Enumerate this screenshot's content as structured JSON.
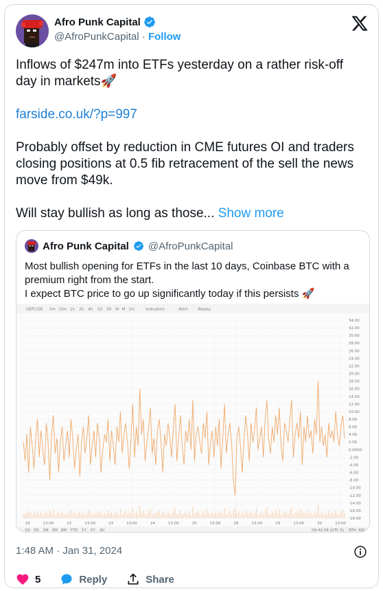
{
  "author": {
    "name": "Afro Punk Capital",
    "handle": "@AfroPunkCapital",
    "separator": "·",
    "follow": "Follow"
  },
  "tweet": {
    "para1": "Inflows of $247m into ETFs yesterday on a rather risk-off day in markets🚀",
    "link": "farside.co.uk/?p=997",
    "para3": "Probably offset by reduction in CME futures OI and traders closing positions at 0.5 fib retracement of the sell the news move from $49k.",
    "para4": "Will stay bullish as long as those...",
    "show_more": "Show more"
  },
  "quote": {
    "name": "Afro Punk Capital",
    "handle": "@AfroPunkCapital",
    "line1": "Most bullish opening for ETFs in the last 10 days, Coinbase BTC with a premium right from the start.",
    "line2": "I expect BTC price to go up significantly today if this persists 🚀"
  },
  "chart_toolbar": {
    "symbol": "GBTC/GE",
    "intervals": [
      "5m",
      "15m",
      "1h",
      "2h",
      "4h",
      "1D",
      "3D",
      "W",
      "M",
      "1m"
    ],
    "indicators": "Indicators",
    "alert": "Alert",
    "replay": "Replay",
    "ranges": [
      "1D",
      "5D",
      "1M",
      "3M",
      "6M",
      "YTD",
      "1Y",
      "5Y",
      "All"
    ],
    "clock": "09:42:58 (UTC-5)",
    "rth": "RTH",
    "adj": "ADJ"
  },
  "chart_data": {
    "type": "line",
    "y_ticks": [
      "34.00",
      "32.00",
      "30.00",
      "28.00",
      "26.00",
      "24.00",
      "22.00",
      "20.00",
      "18.00",
      "16.00",
      "14.00",
      "12.00",
      "10.00",
      "8.00",
      "6.00",
      "4.00",
      "2.00",
      "0.0000",
      "-2.00",
      "-4.00",
      "-6.00",
      "-8.00",
      "-10.00",
      "-12.00",
      "-14.00",
      "-16.00",
      "-18.00"
    ],
    "x_ticks": [
      "19",
      "13:00",
      "22",
      "13:00",
      "23",
      "13:00",
      "24",
      "13:00",
      "25",
      "13:00",
      "26",
      "13:00",
      "29",
      "13:00",
      "30",
      "13:00"
    ],
    "ylim": [
      -18,
      34
    ],
    "series_color": "#f0a868",
    "values": [
      2,
      -3,
      4,
      -6,
      6,
      1,
      -5,
      3,
      8,
      -2,
      5,
      0,
      -4,
      7,
      2,
      -8,
      4,
      9,
      -1,
      3,
      -6,
      2,
      6,
      -3,
      1,
      5,
      -2,
      8,
      3,
      -5,
      0,
      4,
      -7,
      2,
      6,
      -1,
      3,
      9,
      -4,
      1,
      5,
      -2,
      7,
      3,
      -6,
      0,
      4,
      2,
      8,
      -3,
      5,
      1,
      -4,
      6,
      2,
      10,
      -1,
      4,
      7,
      2,
      -5,
      3,
      12,
      -2,
      6,
      1,
      16,
      4,
      8,
      -3,
      2,
      6,
      11,
      -1,
      3,
      -4,
      5,
      8,
      2,
      -6,
      4,
      1,
      7,
      3,
      -2,
      6,
      12,
      -3,
      3,
      9,
      1,
      -4,
      5,
      2,
      8,
      0,
      13,
      -3,
      4,
      6,
      2,
      -1,
      7,
      3,
      10,
      -4,
      2,
      5,
      -2,
      6,
      1,
      8,
      -5,
      3,
      12,
      -1,
      4,
      7,
      2,
      -8,
      -12,
      3,
      6,
      1,
      -6,
      2,
      9,
      4,
      -3,
      7,
      2,
      5,
      11,
      0,
      3,
      6,
      -2,
      8,
      13,
      3,
      -1,
      6,
      2,
      9,
      4,
      11,
      1,
      -3,
      7,
      5,
      2,
      8,
      13,
      -2,
      4,
      7,
      3,
      10,
      -4,
      6,
      2,
      9,
      3,
      5,
      -1,
      8,
      4,
      18,
      2,
      6,
      1,
      4,
      -2,
      7,
      3,
      5,
      2,
      10,
      4,
      1,
      6,
      9,
      3
    ]
  },
  "meta": {
    "time": "1:48 AM",
    "sep": "·",
    "date": "Jan 31, 2024"
  },
  "actions": {
    "likes": "5",
    "reply": "Reply",
    "share": "Share"
  },
  "colors": {
    "accent": "#1d9bf0",
    "heart": "#f91880",
    "verified": "#1d9bf0"
  }
}
